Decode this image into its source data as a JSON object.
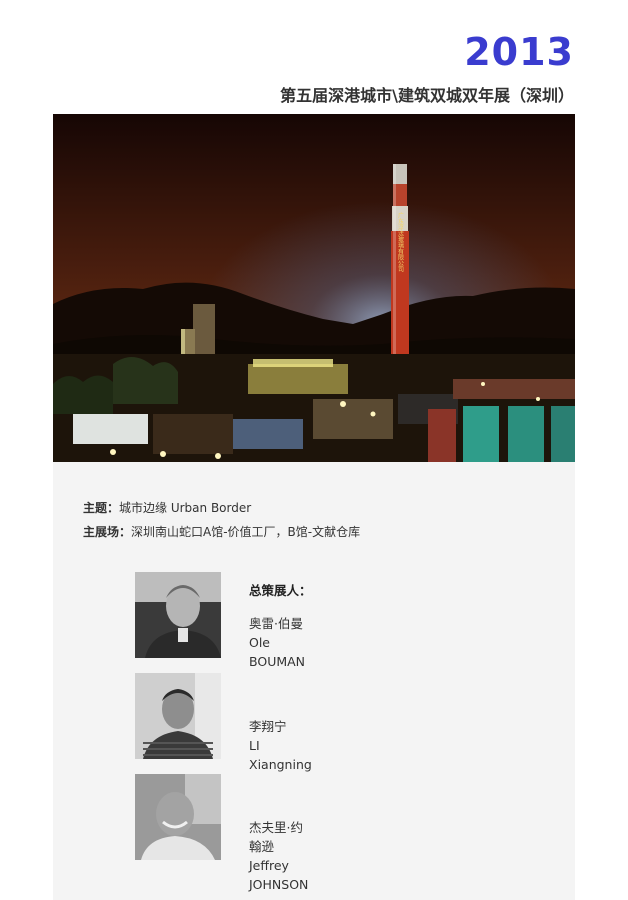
{
  "header": {
    "year": "2013",
    "subtitle": "第五届深港城市\\建筑双城双年展（深圳）"
  },
  "info": {
    "theme_label": "主题：",
    "theme_value": "城市边缘 Urban Border",
    "venue_label": "主展场：",
    "venue_value": "深圳南山蛇口A馆-价值工厂，B馆-文献仓库"
  },
  "curators_heading": "总策展人：",
  "curators": [
    {
      "name_cn": "奥雷·伯曼",
      "name_en": "Ole BOUMAN"
    },
    {
      "name_cn": "李翔宁",
      "name_en": "LI Xiangning"
    },
    {
      "name_cn": "杰夫里·约翰逊",
      "name_en": "Jeffrey JOHNSON"
    }
  ],
  "chimney_text": "广东浮法玻璃有限公司"
}
